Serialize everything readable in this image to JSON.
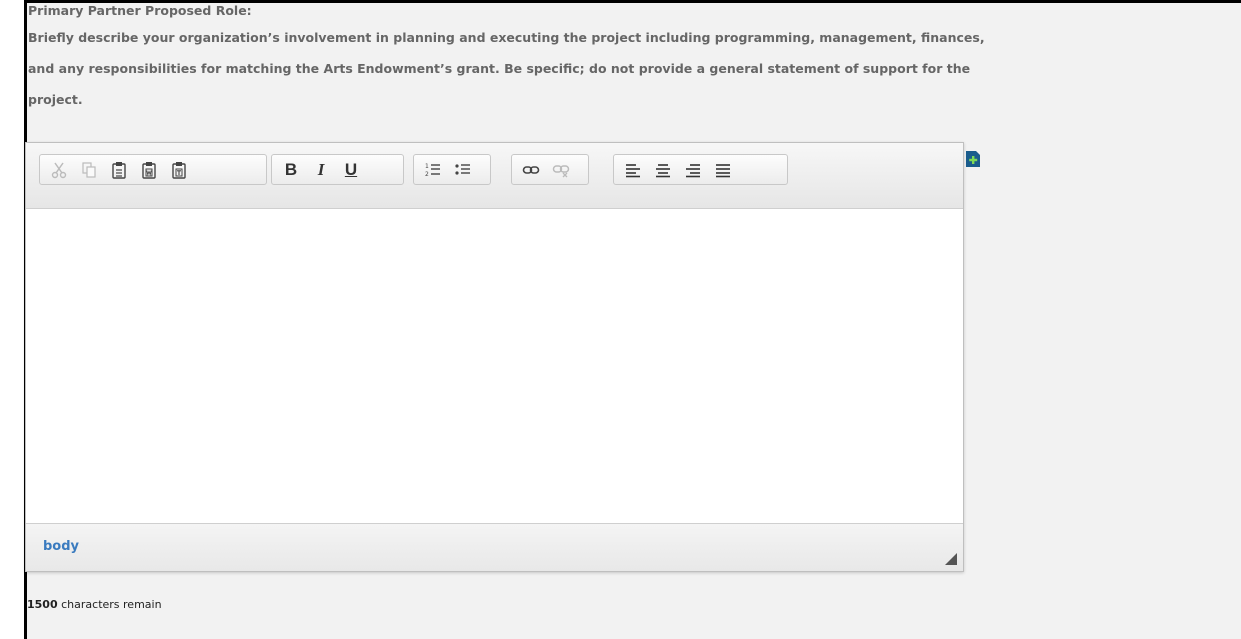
{
  "field": {
    "title": "Primary Partner Proposed Role:",
    "description_lines": [
      "Briefly describe your organization’s involvement in planning and executing the project including programming, management, finances,",
      "and any responsibilities for matching the Arts Endowment’s grant. Be specific; do not provide a general statement of support for the",
      "project."
    ]
  },
  "toolbar": {
    "bold_label": "B",
    "italic_label": "I",
    "underline_label": "U",
    "icons": {
      "clipboard": [
        "cut-icon",
        "copy-icon",
        "paste-icon",
        "paste-from-word-icon",
        "paste-as-text-icon"
      ],
      "format": [
        "bold-icon",
        "italic-icon",
        "underline-icon"
      ],
      "list": [
        "numbered-list-icon",
        "bulleted-list-icon"
      ],
      "link": [
        "link-icon",
        "unlink-icon"
      ],
      "align": [
        "align-left-icon",
        "align-center-icon",
        "align-right-icon",
        "justify-icon"
      ]
    }
  },
  "editor": {
    "content": "",
    "element_path": "body"
  },
  "counter": {
    "count": "1500",
    "suffix": " characters remain"
  },
  "colors": {
    "label": "#666666",
    "path_link": "#3a7bbf",
    "add_icon": "#1a5c8c"
  }
}
